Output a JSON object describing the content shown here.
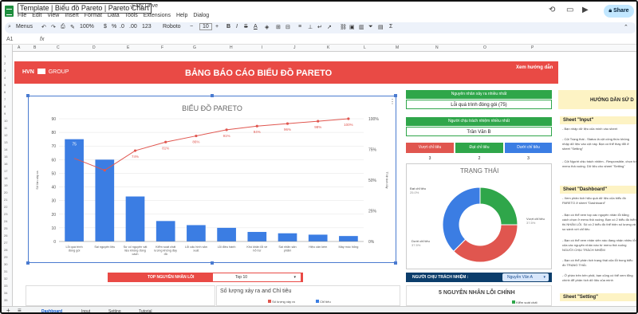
{
  "app": {
    "doc_title": "Template | Biểu đồ Pareto | Pareto Chart",
    "drive_label": "My Drive",
    "share_label": "Share",
    "menus": [
      "File",
      "Edit",
      "View",
      "Insert",
      "Format",
      "Data",
      "Tools",
      "Extensions",
      "Help",
      "Dialog"
    ]
  },
  "toolbar": {
    "menus_label": "Menus",
    "zoom": "100%",
    "currency": "$",
    "percent": "%",
    "dec1": ".0",
    "dec2": ".00",
    "num_fmt": "123",
    "font": "Roboto",
    "font_size": "10",
    "bold": "B",
    "italic": "I",
    "strike": "S",
    "text_color": "A",
    "sigma": "Σ"
  },
  "formula_bar": {
    "cell_ref": "A1",
    "fx": "fx"
  },
  "columns": [
    "A",
    "B",
    "C",
    "D",
    "E",
    "F",
    "G",
    "H",
    "I",
    "J",
    "K",
    "L",
    "M",
    "N",
    "O",
    "P"
  ],
  "header": {
    "logo_text": "HVN",
    "logo_suffix": "GROUP",
    "report_title": "BẢNG BÁO CÁO BIỂU ĐỒ PARETO",
    "guide_link": "Xem hướng dẫn"
  },
  "chart_data": {
    "type": "bar",
    "title": "BIỂU ĐỒ PARETO",
    "ylabel": "Số lần xảy ra",
    "y2label": "Tỉ lệ tích lũy",
    "ylim": [
      0,
      90
    ],
    "yticks": [
      0,
      10,
      20,
      30,
      40,
      50,
      60,
      70,
      80,
      90
    ],
    "y2ticks": [
      "0%",
      "25%",
      "50%",
      "75%",
      "100%"
    ],
    "categories": [
      "Lỗi quá trình đóng gói",
      "Sai nguyên liệu",
      "Sự cố nguyên vật liệu không đúng cách",
      "Kiểm soát chất lượng không đầy đủ",
      "Lỗi cấu hình sản xuất",
      "Lỗi điều hành",
      "Khó khăn lỗi về hỗ trợ",
      "Sai nhãn sản phẩm",
      "Hiệu cân kém",
      "Máy móc hỏng"
    ],
    "values": [
      75,
      60,
      33,
      15,
      12,
      10,
      7,
      6,
      5,
      4
    ],
    "bar_labels": [
      "75",
      "",
      "",
      "",
      "",
      "",
      "",
      "",
      "",
      ""
    ],
    "cumulative_pct": [
      null,
      58,
      74,
      81,
      86,
      91,
      94,
      96,
      98,
      100
    ],
    "cumulative_labels": [
      "",
      "",
      "74%",
      "81%",
      "86%",
      "91%",
      "94%",
      "96%",
      "98%",
      "100%"
    ],
    "colors": {
      "bar": "#3b7de3",
      "line": "#e0564f"
    }
  },
  "cards": {
    "top_cause_label": "Nguyên nhân xảy ra nhiều nhất",
    "top_cause_value": "Lỗi quá trình đóng gói (75)",
    "top_owner_label": "Người chịu trách nhiệm nhiều nhất",
    "top_owner_value": "Trần Văn B",
    "status_headers": [
      "Vượt chỉ tiêu",
      "Đạt chỉ tiêu",
      "Dưới chỉ tiêu"
    ],
    "status_values": [
      "3",
      "2",
      "3"
    ],
    "status_colors": [
      "#e0564f",
      "#2fa64a",
      "#3b7de3"
    ]
  },
  "pie": {
    "title": "TRẠNG THÁI",
    "slices": [
      {
        "label": "Đạt chỉ tiêu",
        "pct_label": "25.0%",
        "value": 25,
        "color": "#2fa64a"
      },
      {
        "label": "Vượt chỉ tiêu",
        "pct_label": "37.5%",
        "value": 37.5,
        "color": "#e0564f"
      },
      {
        "label": "Dưới chỉ tiêu",
        "pct_label": "37.5%",
        "value": 37.5,
        "color": "#3b7de3"
      }
    ]
  },
  "filters": {
    "top_causes_label": "TOP NGUYÊN NHÂN LỖI",
    "top_causes_value": "Top 10",
    "owner_label": "NGƯỜI CHỊU TRÁCH NHIỆM :",
    "owner_value": "Nguyễn Văn A"
  },
  "bottom": {
    "card2_title": "Số lượng xảy ra and Chỉ tiêu",
    "legend1": "Số lượng xảy ra",
    "legend2": "Chỉ tiêu",
    "card3_title": "5 NGUYÊN NHÂN LỖI CHÍNH",
    "card3_legend": "Kiểm soát chất"
  },
  "guide": {
    "title": "HƯỚNG DẪN SỬ D",
    "input_head": "Sheet \"Input\"",
    "input_lines": [
      "- Bạn nhập dữ liệu của mình vào sheet",
      "- Cột Trạng thái - Status là cột công thức không nhập dữ liệu vào cột này. Bạn có thể thay đổi ở sheet \"Setting\"",
      "- Cột Người chịu trách nhiệm - Responsible, chọn từ menu thả xuống. Dữ liệu cho sheet \"Setting\""
    ],
    "dash_head": "Sheet \"Dashboard\"",
    "dash_lines": [
      "- Xem phân tích hiệu quả dữ liệu của biểu đồ PARETO ở sheet \"Dashboard\"",
      "- Bạn có thể xem top các nguyên nhân lỗi bằng cách chọn ở menu thả xuống. Bạn có 2 biểu đồ hiển thị NHÂN LỖI. Số có 2 biểu đồ thể hiện số lượng và so sánh với chỉ tiêu",
      "- Bạn có thể xem nhân viên nào đang nhận nhiều lỗi của các nguyên nhân nào từ menu thả xuống NGƯỜI CHỊU TRÁCH NHIỆM",
      "- Bạn có thể phân tích trạng thái của lỗi trong biểu đồ TRẠNG THÁI.",
      "- Ở phần trên bên phải, bạn cũng có thể xem tổng chính để phân tích dữ liệu của mình"
    ],
    "setting_head": "Sheet \"Setting\""
  },
  "tabs": [
    "Dashboard",
    "Input",
    "Setting",
    "Tutorial"
  ]
}
